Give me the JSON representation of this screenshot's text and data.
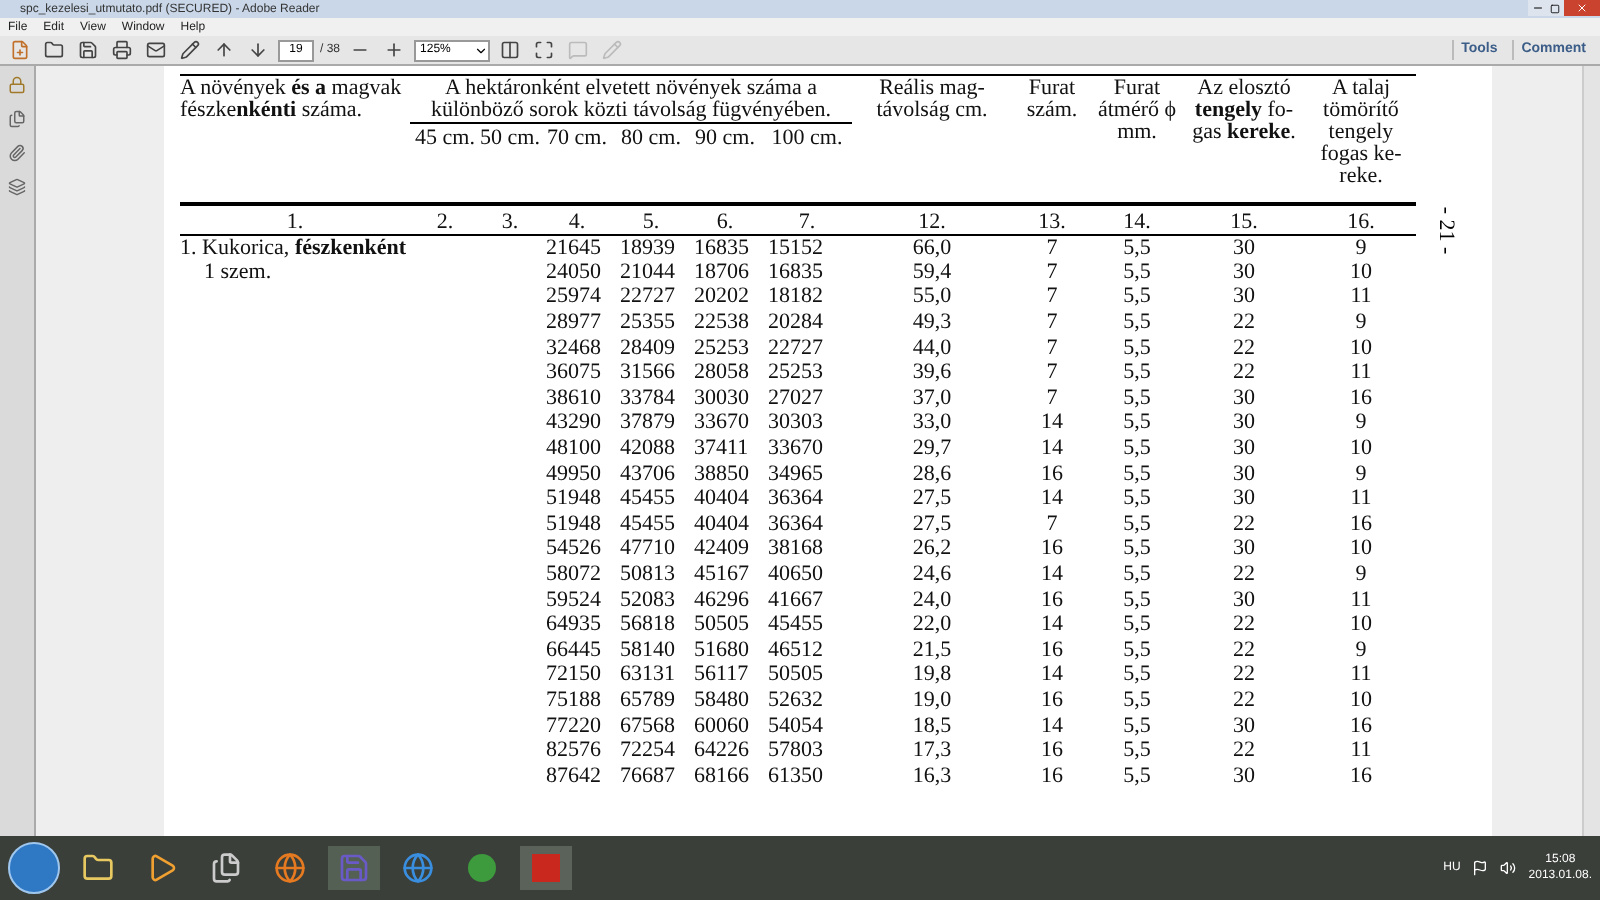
{
  "window": {
    "title": "spc_kezelesi_utmutato.pdf (SECURED) - Adobe Reader"
  },
  "menu": [
    "File",
    "Edit",
    "View",
    "Window",
    "Help"
  ],
  "toolbar": {
    "page": "19",
    "page_total": "/ 38",
    "zoom": "125%"
  },
  "toolbar_right": [
    "Tools",
    "Comment"
  ],
  "table": {
    "caption_column": "A növények **és a** magvak fészke**nkénti** száma.",
    "group_heading": "A hektáronként elvetett növények száma a különböző sorok közti távolság fügvényében.",
    "distance_columns": [
      "45 cm.",
      "50 cm.",
      "70 cm.",
      "80 cm.",
      "90 cm.",
      "100 cm."
    ],
    "other_columns": [
      "Reális mag-távolság cm.",
      "Furat szám.",
      "Furat átmérő ϕ mm.",
      "Az elosztó **tengely** fo-gas **kereke**.",
      "A talaj tömörítő tengely fogas ke-reke."
    ],
    "column_numbers": [
      "1.",
      "2.",
      "3.",
      "4.",
      "5.",
      "6.",
      "7.",
      "12.",
      "13.",
      "14.",
      "15.",
      "16."
    ],
    "rows": [
      {
        "label": "1. Kukorica, **fészkenként**",
        "values": [
          "21645",
          "18939",
          "16835",
          "15152",
          "66,0",
          "7",
          "5,5",
          "30",
          "9"
        ]
      },
      {
        "label": "1 szem.",
        "values": [
          "24050",
          "21044",
          "18706",
          "16835",
          "59,4",
          "7",
          "5,5",
          "30",
          "10"
        ]
      },
      {
        "values": [
          "25974",
          "22727",
          "20202",
          "18182",
          "55,0",
          "7",
          "5,5",
          "30",
          "11"
        ]
      },
      {
        "values": [
          "28977",
          "25355",
          "22538",
          "20284",
          "49,3",
          "7",
          "5,5",
          "22",
          "9"
        ]
      },
      {
        "values": [
          "32468",
          "28409",
          "25253",
          "22727",
          "44,0",
          "7",
          "5,5",
          "22",
          "10"
        ]
      },
      {
        "values": [
          "36075",
          "31566",
          "28058",
          "25253",
          "39,6",
          "7",
          "5,5",
          "22",
          "11"
        ]
      },
      {
        "values": [
          "38610",
          "33784",
          "30030",
          "27027",
          "37,0",
          "7",
          "5,5",
          "30",
          "16"
        ]
      },
      {
        "values": [
          "43290",
          "37879",
          "33670",
          "30303",
          "33,0",
          "14",
          "5,5",
          "30",
          "9"
        ]
      },
      {
        "values": [
          "48100",
          "42088",
          "37411",
          "33670",
          "29,7",
          "14",
          "5,5",
          "30",
          "10"
        ]
      },
      {
        "values": [
          "49950",
          "43706",
          "38850",
          "34965",
          "28,6",
          "16",
          "5,5",
          "30",
          "9"
        ]
      },
      {
        "values": [
          "51948",
          "45455",
          "40404",
          "36364",
          "27,5",
          "14",
          "5,5",
          "30",
          "11"
        ]
      },
      {
        "values": [
          "51948",
          "45455",
          "40404",
          "36364",
          "27,5",
          "7",
          "5,5",
          "22",
          "16"
        ]
      },
      {
        "values": [
          "54526",
          "47710",
          "42409",
          "38168",
          "26,2",
          "16",
          "5,5",
          "30",
          "10"
        ]
      },
      {
        "values": [
          "58072",
          "50813",
          "45167",
          "40650",
          "24,6",
          "14",
          "5,5",
          "22",
          "9"
        ]
      },
      {
        "values": [
          "59524",
          "52083",
          "46296",
          "41667",
          "24,0",
          "16",
          "5,5",
          "30",
          "11"
        ]
      },
      {
        "values": [
          "64935",
          "56818",
          "50505",
          "45455",
          "22,0",
          "14",
          "5,5",
          "22",
          "10"
        ]
      },
      {
        "values": [
          "66445",
          "58140",
          "51680",
          "46512",
          "21,5",
          "16",
          "5,5",
          "22",
          "9"
        ]
      },
      {
        "values": [
          "72150",
          "63131",
          "56117",
          "50505",
          "19,8",
          "14",
          "5,5",
          "22",
          "11"
        ]
      },
      {
        "values": [
          "75188",
          "65789",
          "58480",
          "52632",
          "19,0",
          "16",
          "5,5",
          "22",
          "10"
        ]
      },
      {
        "values": [
          "77220",
          "67568",
          "60060",
          "54054",
          "18,5",
          "14",
          "5,5",
          "30",
          "16"
        ]
      },
      {
        "values": [
          "82576",
          "72254",
          "64226",
          "57803",
          "17,3",
          "16",
          "5,5",
          "22",
          "11"
        ]
      },
      {
        "values": [
          "87642",
          "76687",
          "68166",
          "61350",
          "16,3",
          "16",
          "5,5",
          "30",
          "16"
        ]
      }
    ]
  },
  "page_number": "- 21 -",
  "taskbar": {
    "language": "HU",
    "time": "15:08",
    "date": "2013.01.08."
  }
}
